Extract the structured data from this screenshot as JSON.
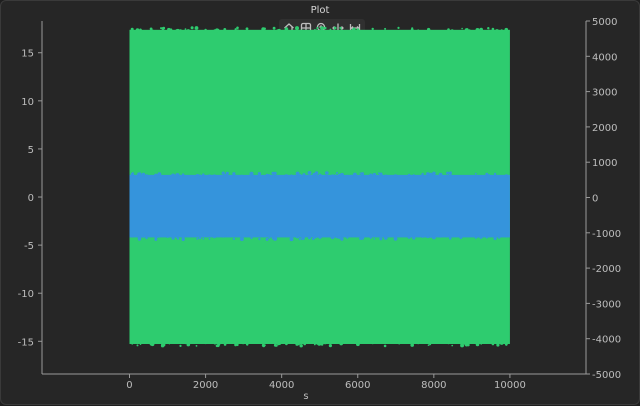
{
  "window": {
    "title": "Plot"
  },
  "toolbar": {
    "tools": [
      {
        "icon": "home-icon"
      },
      {
        "icon": "grid-icon"
      },
      {
        "icon": "zoom-icon"
      },
      {
        "icon": "pan-horizontal-icon"
      },
      {
        "icon": "fit-width-icon"
      }
    ]
  },
  "colors": {
    "background": "#262626",
    "axis": "#9a9a9a",
    "green_series": "#2ecc6f",
    "blue_series": "#3594dc"
  },
  "chart_data": {
    "type": "scatter",
    "title": "",
    "xlabel": "s",
    "ylabel": "",
    "xlim": [
      -2300,
      12000
    ],
    "ylim_left": [
      -18.4,
      18.3
    ],
    "ylim_right": [
      -5000,
      5000
    ],
    "x_ticks": [
      0,
      2000,
      4000,
      6000,
      8000,
      10000
    ],
    "y_left_ticks": [
      -15,
      -10,
      -5,
      0,
      5,
      10,
      15
    ],
    "y_right_ticks": [
      -5000,
      -4000,
      -3000,
      -2000,
      -1000,
      0,
      1000,
      2000,
      3000,
      4000,
      5000
    ],
    "series": [
      {
        "axis": "right",
        "color": "#2ecc6f",
        "x_range": [
          0,
          10000
        ],
        "y_range": [
          -4150,
          4750
        ]
      },
      {
        "axis": "left",
        "color": "#3594dc",
        "x_range": [
          0,
          10000
        ],
        "y_range": [
          -4.2,
          2.3
        ]
      }
    ]
  }
}
